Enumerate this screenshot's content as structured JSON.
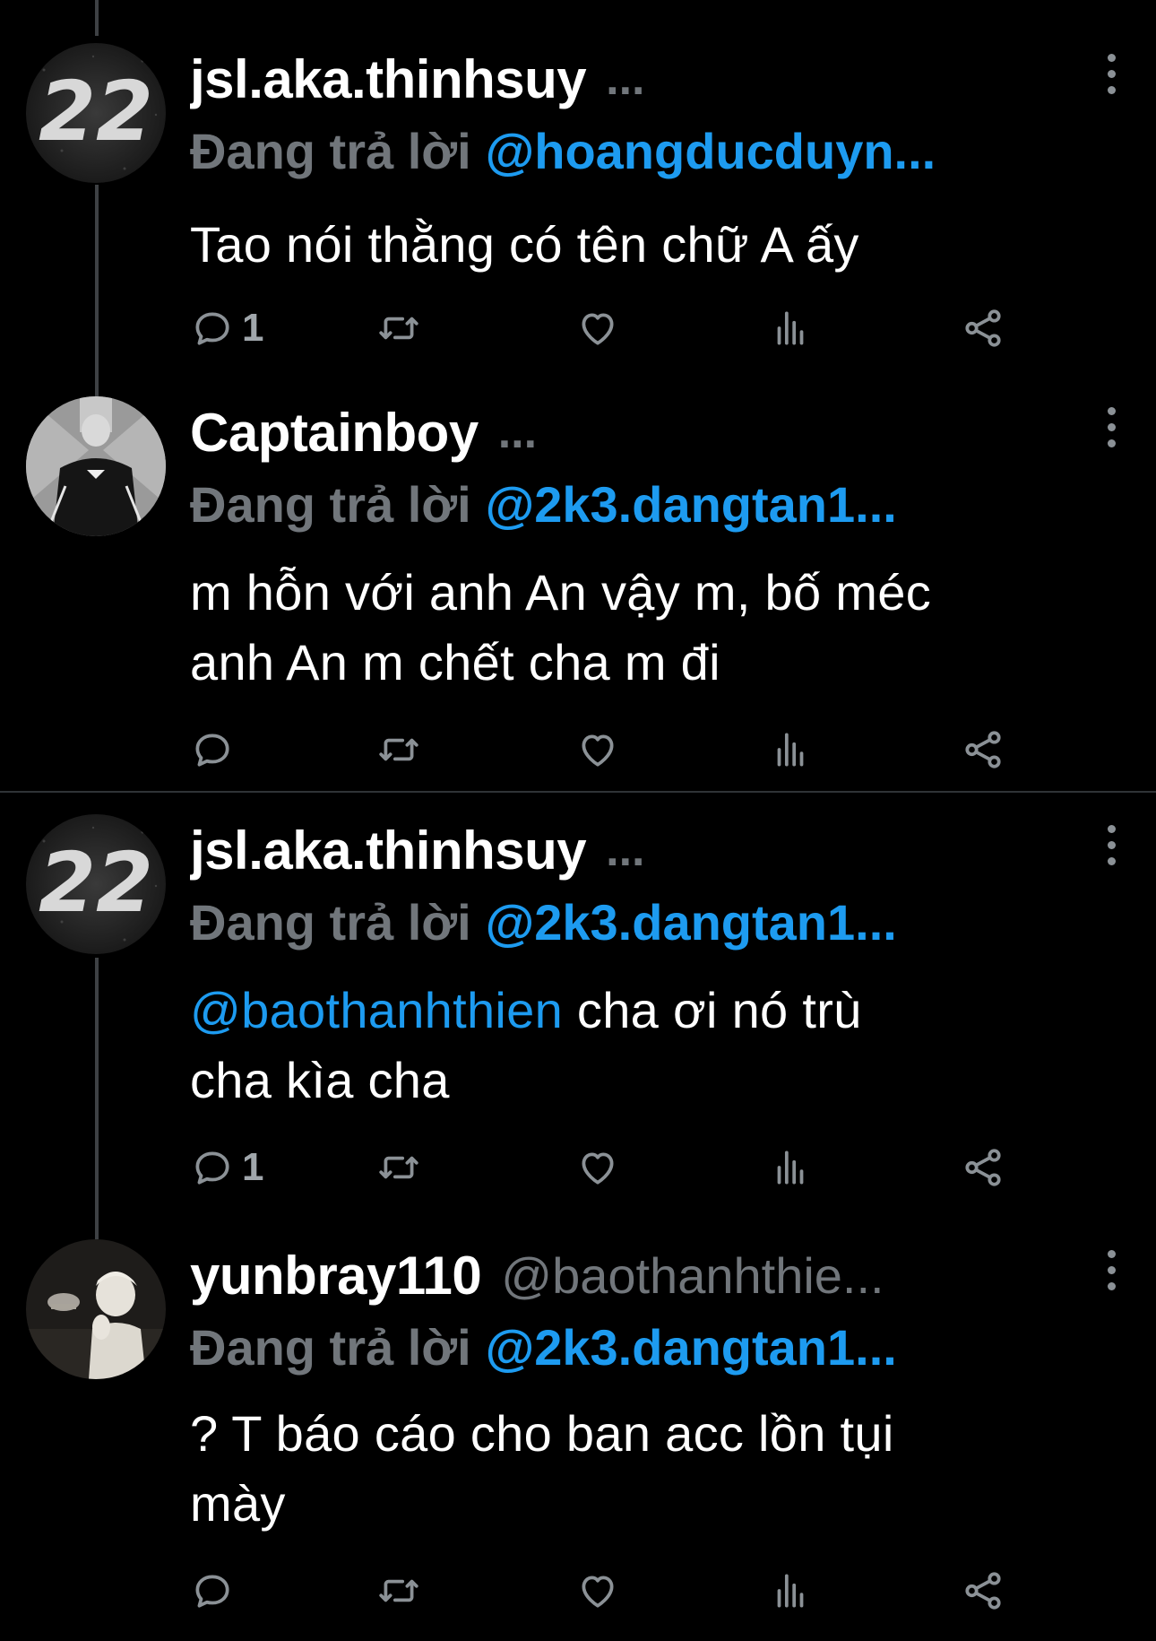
{
  "tweets": [
    {
      "display_name": "jsl.aka.thinhsuy",
      "name_suffix": "...",
      "reply_prefix": "Đang trả lời",
      "reply_to": "@hoangducduyn...",
      "text": "Tao nói thằng có tên chữ A ấy",
      "reply_count": "1",
      "avatar": "avatar-22"
    },
    {
      "display_name": "Captainboy",
      "name_suffix": "...",
      "reply_prefix": "Đang trả lời",
      "reply_to": "@2k3.dangtan1...",
      "text_line1": "m hỗn với anh An vậy m, bố méc",
      "text_line2": "anh An m chết cha m đi",
      "reply_count": "",
      "avatar": "avatar-photo-jacket"
    },
    {
      "display_name": "jsl.aka.thinhsuy",
      "name_suffix": "...",
      "reply_prefix": "Đang trả lời",
      "reply_to": "@2k3.dangtan1...",
      "mention": "@baothanhthien",
      "text_after_mention": " cha ơi nó trù",
      "text_line2": "cha kìa cha",
      "reply_count": "1",
      "avatar": "avatar-22"
    },
    {
      "display_name": "yunbray110",
      "handle": "@baothanhthie...",
      "reply_prefix": "Đang trả lời",
      "reply_to": "@2k3.dangtan1...",
      "text_line1": "? T báo cáo cho ban acc lồn tụi",
      "text_line2": "mày",
      "reply_count": "",
      "avatar": "avatar-photo-person"
    }
  ],
  "icons": {
    "reply": "comment-bubble-icon",
    "retweet": "retweet-icon",
    "like": "heart-icon",
    "views": "analytics-bars-icon",
    "share": "share-icon",
    "more": "more-vertical-icon"
  },
  "colors": {
    "background": "#000000",
    "text": "#ffffff",
    "muted": "#71767b",
    "link": "#1d9bf0",
    "icon": "#8b9196"
  }
}
